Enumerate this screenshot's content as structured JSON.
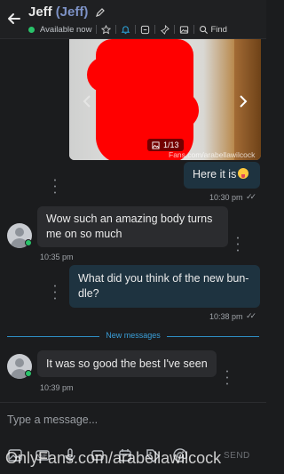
{
  "header": {
    "name": "Jeff",
    "alias": "(Jeff)",
    "status": "Available now",
    "find_label": "Find"
  },
  "media": {
    "counter": "1/13",
    "watermark": "Fans.com/arabellawilcock"
  },
  "messages": [
    {
      "text": "Here it is",
      "time": "10:30 pm"
    },
    {
      "text": "Wow such an amazing body turns me on so much",
      "time": "10:35 pm"
    },
    {
      "text": "What did you think of the new bundle?",
      "line1": "What did you think of the new bun-",
      "line2": "dle?",
      "time": "10:38 pm"
    },
    {
      "text": "It was so good the best I've seen",
      "time": "10:39 pm"
    }
  ],
  "divider": {
    "label": "New messages"
  },
  "composer": {
    "placeholder": "Type a message...",
    "send_label": "SEND"
  },
  "watermark": "OnlyFans.com/arabellawilcock",
  "colors": {
    "background": "#1b1c1e",
    "outgoing_bubble": "#1e3340",
    "incoming_bubble": "#2b2c2f",
    "accent": "#2fa8e0",
    "online": "#29c36a",
    "censor": "#ff0000"
  }
}
